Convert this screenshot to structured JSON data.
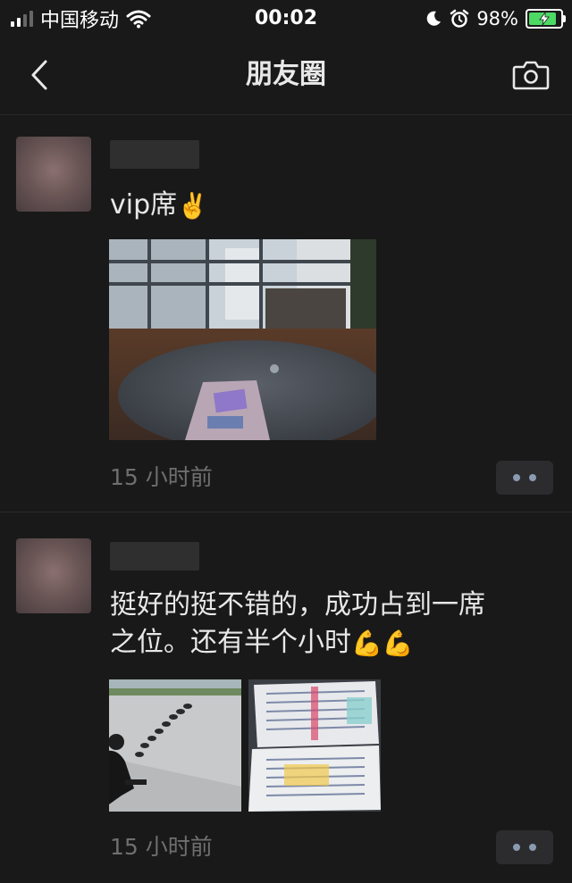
{
  "status_bar": {
    "carrier": "中国移动",
    "time": "00:02",
    "battery_percent": "98%",
    "icons": [
      "signal-icon",
      "wifi-icon",
      "moon-icon",
      "alarm-icon",
      "battery-charging-icon"
    ]
  },
  "nav": {
    "title": "朋友圈",
    "back_icon": "chevron-left-icon",
    "camera_icon": "camera-icon"
  },
  "posts": [
    {
      "text": "vip席",
      "emoji": "✌️",
      "time": "15 小时前",
      "images": [
        "room-table-photo"
      ]
    },
    {
      "text_line1": "挺好的挺不错的，成功占到一席",
      "text_line2": "之位。还有半个小时",
      "emoji": "💪💪",
      "time": "15 小时前",
      "images": [
        "plaza-queue-photo",
        "textbook-photo"
      ]
    }
  ],
  "colors": {
    "background": "#191919",
    "text": "#e8e8e8",
    "time_text": "#6f6f6f",
    "more_dots": "#8a9bb0",
    "battery_fill": "#4cd964"
  }
}
